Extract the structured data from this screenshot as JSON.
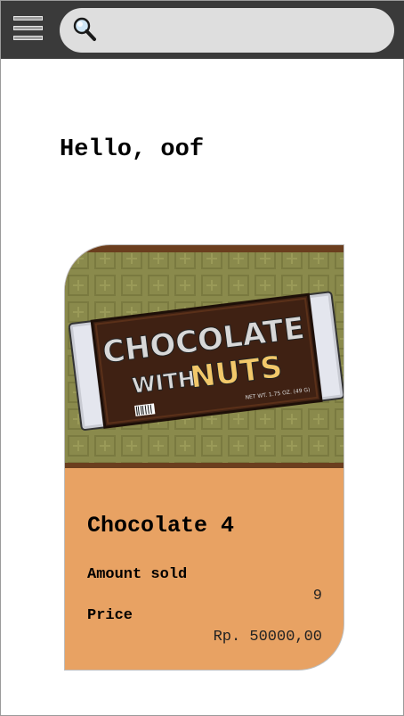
{
  "header": {
    "menu_icon": "hamburger-menu-icon",
    "search_icon": "magnifier-icon",
    "search_placeholder": "",
    "search_value": "",
    "bar_color": "#3a3a3a",
    "search_bg": "#dedede"
  },
  "greeting": "Hello, oof",
  "product": {
    "image_text_line1": "CHOCOLATE",
    "image_text_line2": "WITH",
    "image_text_line3": "NUTS",
    "image_weight": "NET WT. 1.75 OZ. (49 G)",
    "name": "Chocolate 4",
    "amount_sold_label": "Amount sold",
    "amount_sold_value": "9",
    "price_label": "Price",
    "price_value": "Rp. 50000,00",
    "card_color": "#e8a263"
  }
}
